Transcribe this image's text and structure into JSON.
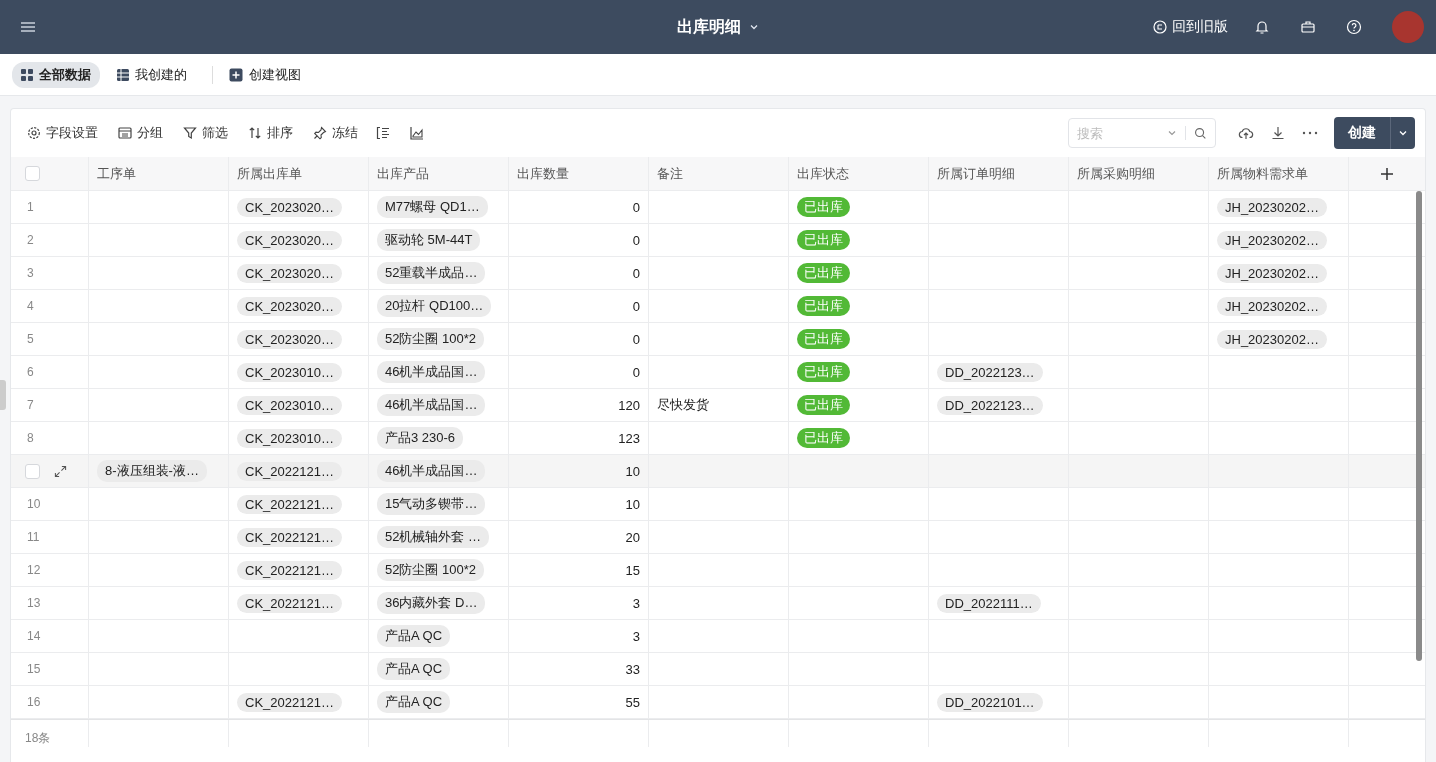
{
  "header": {
    "title": "出库明细",
    "back_link": "回到旧版"
  },
  "views": [
    {
      "label": "全部数据",
      "selected": true
    },
    {
      "label": "我创建的",
      "selected": false
    }
  ],
  "create_view": "创建视图",
  "toolbar": {
    "actions": [
      {
        "label": "字段设置",
        "kind": "gear"
      },
      {
        "label": "分组",
        "kind": "group"
      },
      {
        "label": "筛选",
        "kind": "filter"
      },
      {
        "label": "排序",
        "kind": "sort"
      },
      {
        "label": "冻结",
        "kind": "pin"
      }
    ],
    "search": {
      "placeholder": "搜索"
    },
    "create_button": "创建"
  },
  "table": {
    "all_checked": false,
    "columns": [
      {
        "label": "工序单",
        "kind": "pill"
      },
      {
        "label": "所属出库单",
        "kind": "pill"
      },
      {
        "label": "出库产品",
        "kind": "pill"
      },
      {
        "label": "出库数量",
        "kind": "number"
      },
      {
        "label": "备注",
        "kind": "text"
      },
      {
        "label": "出库状态",
        "kind": "status"
      },
      {
        "label": "所属订单明细",
        "kind": "pill"
      },
      {
        "label": "所属采购明细",
        "kind": "pill"
      },
      {
        "label": "所属物料需求单",
        "kind": "pill"
      }
    ],
    "rows": [
      {
        "number": "1",
        "hovered": false,
        "cells": [
          null,
          "CK_2023020…",
          "M77螺母 QD1…",
          "0",
          null,
          "已出库",
          null,
          null,
          "JH_20230202…"
        ]
      },
      {
        "number": "2",
        "hovered": false,
        "cells": [
          null,
          "CK_2023020…",
          "驱动轮 5M-44T",
          "0",
          null,
          "已出库",
          null,
          null,
          "JH_20230202…"
        ]
      },
      {
        "number": "3",
        "hovered": false,
        "cells": [
          null,
          "CK_2023020…",
          "52重载半成品…",
          "0",
          null,
          "已出库",
          null,
          null,
          "JH_20230202…"
        ]
      },
      {
        "number": "4",
        "hovered": false,
        "cells": [
          null,
          "CK_2023020…",
          "20拉杆 QD100…",
          "0",
          null,
          "已出库",
          null,
          null,
          "JH_20230202…"
        ]
      },
      {
        "number": "5",
        "hovered": false,
        "cells": [
          null,
          "CK_2023020…",
          "52防尘圈 100*2",
          "0",
          null,
          "已出库",
          null,
          null,
          "JH_20230202…"
        ]
      },
      {
        "number": "6",
        "hovered": false,
        "cells": [
          null,
          "CK_2023010…",
          "46机半成品国…",
          "0",
          null,
          "已出库",
          "DD_2022123…",
          null,
          null
        ]
      },
      {
        "number": "7",
        "hovered": false,
        "cells": [
          null,
          "CK_2023010…",
          "46机半成品国…",
          "120",
          "尽快发货",
          "已出库",
          "DD_2022123…",
          null,
          null
        ]
      },
      {
        "number": "8",
        "hovered": false,
        "cells": [
          null,
          "CK_2023010…",
          "产品3 230-6",
          "123",
          null,
          "已出库",
          null,
          null,
          null
        ]
      },
      {
        "hovered": true,
        "checked": false,
        "cells": [
          "8-液压组装-液…",
          "CK_2022121…",
          "46机半成品国…",
          "10",
          null,
          null,
          null,
          null,
          null
        ]
      },
      {
        "number": "10",
        "hovered": false,
        "cells": [
          null,
          "CK_2022121…",
          "15气动多锲带…",
          "10",
          null,
          null,
          null,
          null,
          null
        ]
      },
      {
        "number": "11",
        "hovered": false,
        "cells": [
          null,
          "CK_2022121…",
          "52机械轴外套 …",
          "20",
          null,
          null,
          null,
          null,
          null
        ]
      },
      {
        "number": "12",
        "hovered": false,
        "cells": [
          null,
          "CK_2022121…",
          "52防尘圈 100*2",
          "15",
          null,
          null,
          null,
          null,
          null
        ]
      },
      {
        "number": "13",
        "hovered": false,
        "cells": [
          null,
          "CK_2022121…",
          "36内藏外套 D…",
          "3",
          null,
          null,
          "DD_2022111…",
          null,
          null
        ]
      },
      {
        "number": "14",
        "hovered": false,
        "cells": [
          null,
          null,
          "产品A QC",
          "3",
          null,
          null,
          null,
          null,
          null
        ]
      },
      {
        "number": "15",
        "hovered": false,
        "cells": [
          null,
          null,
          "产品A QC",
          "33",
          null,
          null,
          null,
          null,
          null
        ]
      },
      {
        "number": "16",
        "hovered": false,
        "cells": [
          null,
          "CK_2022121…",
          "产品A QC",
          "55",
          null,
          null,
          "DD_2022101…",
          null,
          null
        ]
      }
    ],
    "record_count": "18条"
  }
}
